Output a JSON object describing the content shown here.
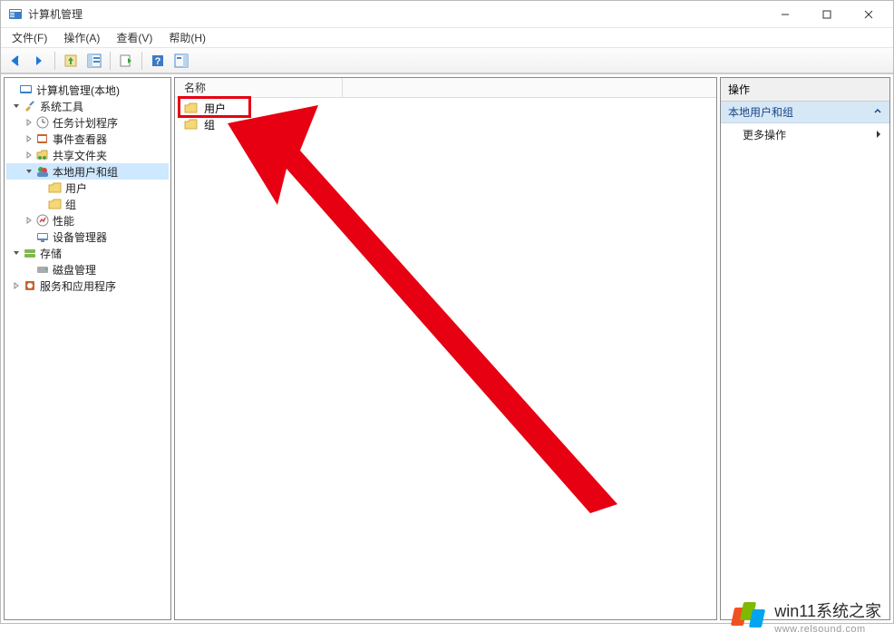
{
  "window": {
    "title": "计算机管理"
  },
  "menu": {
    "file": "文件(F)",
    "action": "操作(A)",
    "view": "查看(V)",
    "help": "帮助(H)"
  },
  "tree": {
    "root": "计算机管理(本地)",
    "system_tools": "系统工具",
    "task_scheduler": "任务计划程序",
    "event_viewer": "事件查看器",
    "shared_folders": "共享文件夹",
    "local_users_groups": "本地用户和组",
    "users": "用户",
    "groups": "组",
    "performance": "性能",
    "device_manager": "设备管理器",
    "storage": "存储",
    "disk_management": "磁盘管理",
    "services_apps": "服务和应用程序"
  },
  "list": {
    "header_name": "名称",
    "items": [
      "用户",
      "组"
    ]
  },
  "actions": {
    "header": "操作",
    "group_title": "本地用户和组",
    "more_actions": "更多操作"
  },
  "watermark": {
    "line1": "win11系统之家",
    "line2": "www.relsound.com"
  }
}
